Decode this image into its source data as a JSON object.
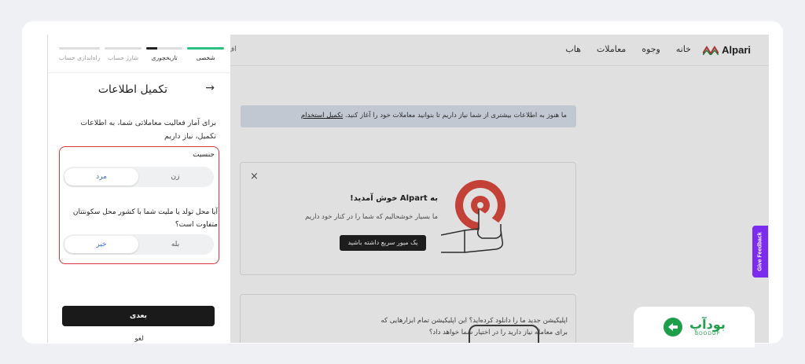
{
  "app": {
    "brand": "Alpari",
    "nav": [
      "خانه",
      "وجوه",
      "معاملات",
      "هاب"
    ],
    "partial_nav": "اف",
    "banner_text": "ما هنوز به اطلاعات بیشتری از شما نیاز داریم تا بتوانید معاملات خود را آغاز کنید.",
    "banner_link": "تکمیل استخدام",
    "welcome_title": "به Alpart خوش آمدید!",
    "welcome_text": "ما بسیار خوشحالیم که شما را در کنار خود داریم",
    "tour_button": "یک میور سریع داشته باشید",
    "close_icon": "×",
    "app_promo": "اپلیکیشن جدید ما را دانلود کرده‌اید؟ این اپلیکیشن تمام ابزارهایی که برای معامله نیاز دارید را در اختیار شما خواهد داد؟",
    "feedback": "Give Feedback"
  },
  "drawer": {
    "steps": [
      {
        "label": "شخصی",
        "state": "done"
      },
      {
        "label": "تاریخچوری",
        "state": "current"
      },
      {
        "label": "شارژ حساب",
        "state": "todo"
      },
      {
        "label": "راه‌اندازی حساب",
        "state": "todo"
      }
    ],
    "back_icon": "arrow-right-icon",
    "title": "تکمیل اطلاعات",
    "intro": "برای آمار فعالیت معاملاتی شما، به اطلاعات تکمیل، نیاز داریم",
    "gender_label": "جنسیت",
    "gender_options": [
      "مرد",
      "زن"
    ],
    "gender_selected": "مرد",
    "q2": "آیا محل تولد یا ملیت شما با کشور محل سکونتتان متفاوت است؟",
    "q2_options": [
      "خیر",
      "بله"
    ],
    "q2_selected": "خیر",
    "next": "بعدی",
    "cancel": "لغو"
  },
  "watermark": {
    "title": "بودآپ",
    "sub": "BOODUP"
  },
  "colors": {
    "accent_green": "#2bbf83",
    "highlight_red": "#d9343f",
    "feedback_purple": "#7b2cf0",
    "selected_blue": "#3a6fd8"
  }
}
